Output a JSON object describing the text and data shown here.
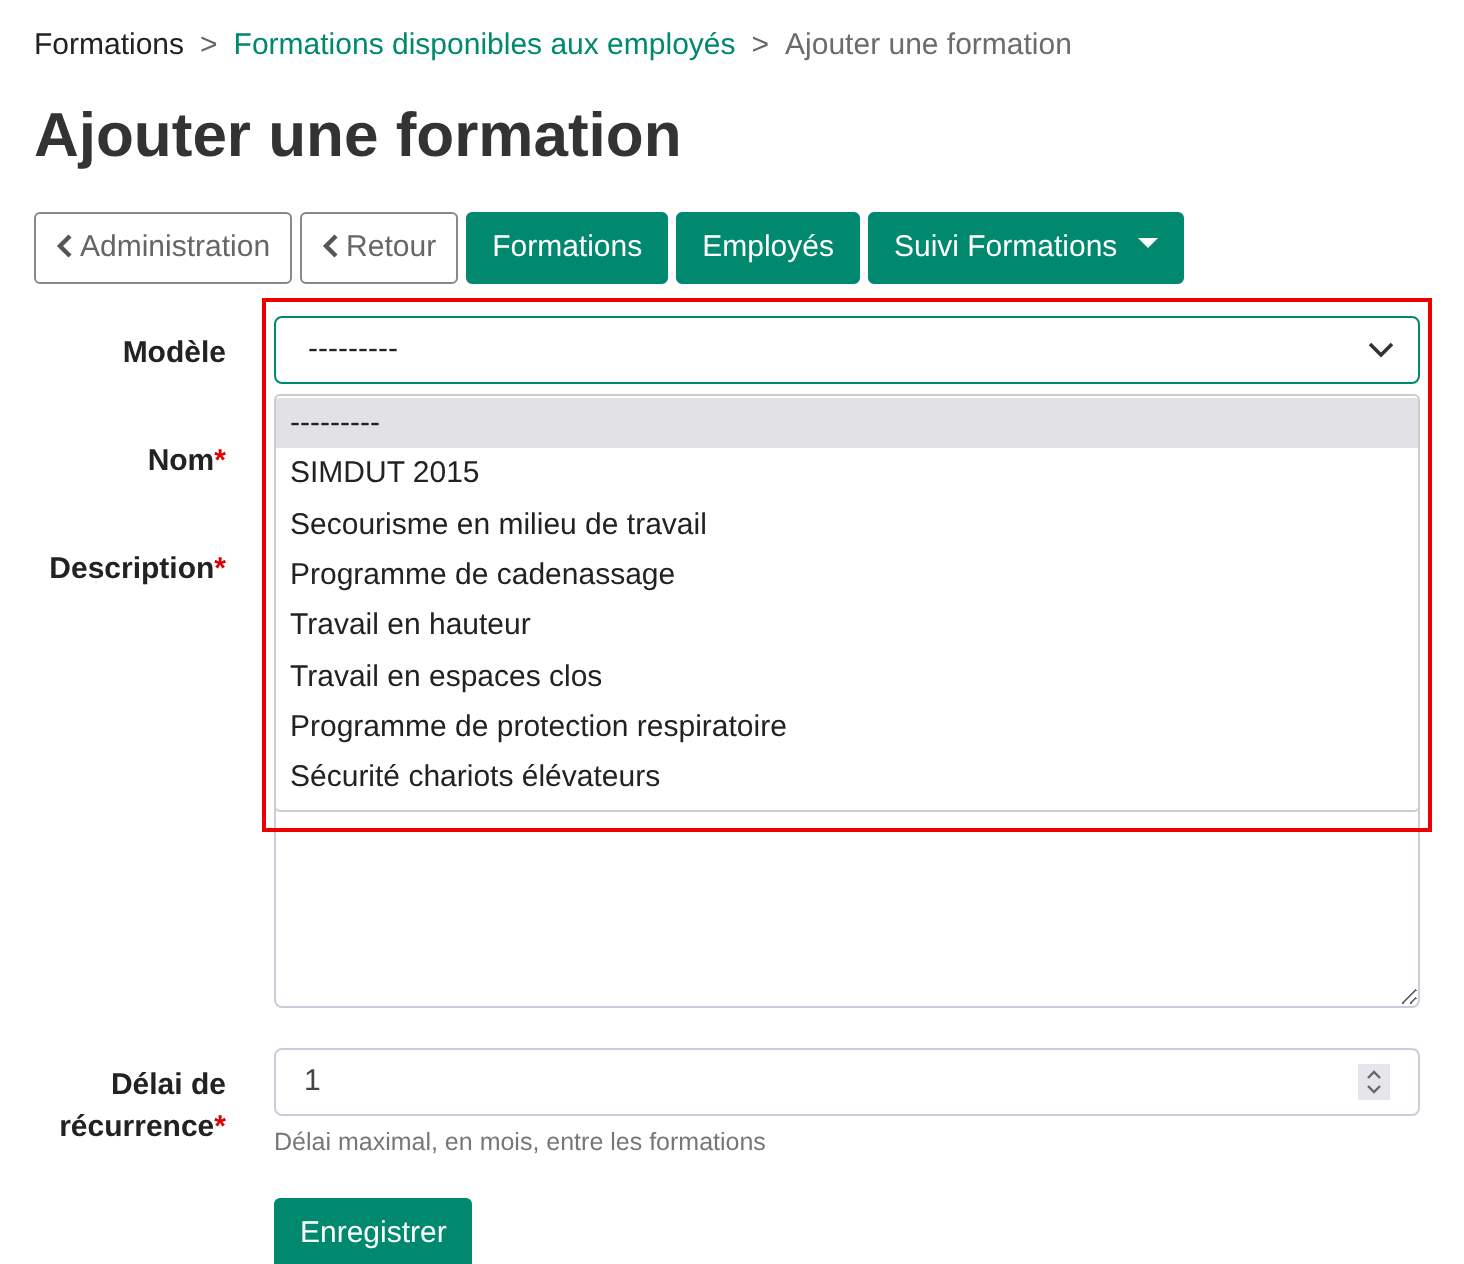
{
  "breadcrumb": {
    "separator": ">",
    "items": [
      {
        "label": "Formations",
        "kind": "plain"
      },
      {
        "label": "Formations disponibles aux employés",
        "kind": "link"
      },
      {
        "label": "Ajouter une formation",
        "kind": "current"
      }
    ]
  },
  "title": "Ajouter une formation",
  "nav_buttons": [
    {
      "label": "Administration",
      "kind": "back"
    },
    {
      "label": "Retour",
      "kind": "back"
    },
    {
      "label": "Formations",
      "kind": "primary"
    },
    {
      "label": "Employés",
      "kind": "primary"
    },
    {
      "label": "Suivi Formations",
      "kind": "dropdown"
    }
  ],
  "form": {
    "required_mark": "*",
    "model": {
      "label": "Modèle",
      "value": "---------",
      "expanded": true,
      "highlighted": true,
      "options": [
        {
          "label": "---------",
          "selected": true
        },
        {
          "label": "SIMDUT 2015",
          "selected": false
        },
        {
          "label": "Secourisme en milieu de travail",
          "selected": false
        },
        {
          "label": "Programme de cadenassage",
          "selected": false
        },
        {
          "label": "Travail en hauteur",
          "selected": false
        },
        {
          "label": "Travail en espaces clos",
          "selected": false
        },
        {
          "label": "Programme de protection respiratoire",
          "selected": false
        },
        {
          "label": "Sécurité chariots élévateurs",
          "selected": false
        }
      ]
    },
    "name": {
      "label": "Nom",
      "required": true
    },
    "description": {
      "label": "Description",
      "required": true
    },
    "recurrence": {
      "label": "Délai de récurrence",
      "required": true,
      "value": "1",
      "help": "Délai maximal, en mois, entre les formations"
    },
    "submit": "Enregistrer"
  }
}
